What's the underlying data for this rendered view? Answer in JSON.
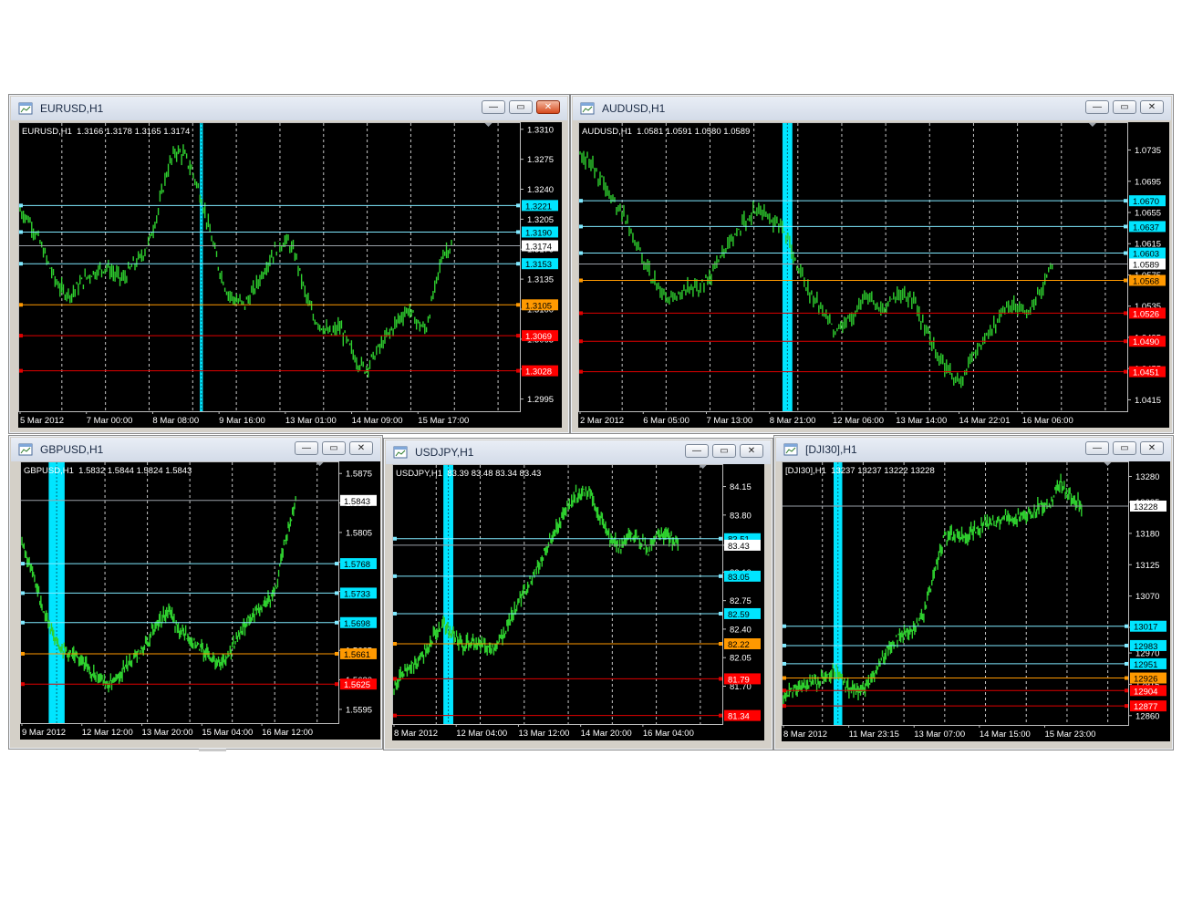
{
  "colors": {
    "background": "#000000",
    "candle": "#2fd12f",
    "grid": "#c8c8c8",
    "cyan_level": "#7fe9ff",
    "orange_level": "#ff9900",
    "red_level": "#e00000",
    "highlight_band": "#00e5ff",
    "price_tag": "#ffffff"
  },
  "icons": {
    "window": "chart-window-icon",
    "minimize": "minimize-icon",
    "maximize": "maximize-icon",
    "close": "close-icon"
  },
  "windows": [
    {
      "title": "EURUSD,H1",
      "info": "EURUSD,H1  1.3166 1.3178 1.3165 1.3174",
      "close_active": true,
      "ymin": 1.2985,
      "ymax": 1.3314,
      "y_ticks": [
        "1.3310",
        "1.3275",
        "1.3240",
        "1.3205",
        "1.3170",
        "1.3135",
        "1.3100",
        "1.3065",
        "1.3030",
        "1.2995"
      ],
      "x_labels": [
        "5 Mar 2012",
        "7 Mar 00:00",
        "8 Mar 08:00",
        "9 Mar 16:00",
        "13 Mar 01:00",
        "14 Mar 09:00",
        "15 Mar 17:00"
      ],
      "levels": [
        {
          "value": 1.3221,
          "label": "1.3221",
          "kind": "cyan"
        },
        {
          "value": 1.319,
          "label": "1.3190",
          "kind": "cyan"
        },
        {
          "value": 1.3153,
          "label": "1.3153",
          "kind": "cyan"
        },
        {
          "value": 1.3105,
          "label": "1.3105",
          "kind": "orange"
        },
        {
          "value": 1.3069,
          "label": "1.3069",
          "kind": "red"
        },
        {
          "value": 1.3028,
          "label": "1.3028",
          "kind": "red"
        }
      ],
      "current": {
        "value": 1.3174,
        "label": "1.3174"
      },
      "band_fraction": 0.362,
      "band_fraction_width": 0.006,
      "series": [
        1.3215,
        1.3205,
        1.3185,
        1.316,
        1.3135,
        1.312,
        1.3118,
        1.313,
        1.314,
        1.3145,
        1.315,
        1.314,
        1.3135,
        1.315,
        1.316,
        1.318,
        1.3215,
        1.326,
        1.3285,
        1.328,
        1.326,
        1.323,
        1.319,
        1.315,
        1.312,
        1.311,
        1.3105,
        1.312,
        1.314,
        1.316,
        1.3175,
        1.318,
        1.316,
        1.312,
        1.309,
        1.308,
        1.307,
        1.308,
        1.306,
        1.304,
        1.303,
        1.3045,
        1.306,
        1.3075,
        1.309,
        1.31,
        1.3085,
        1.3075,
        1.312,
        1.3165,
        1.3174
      ]
    },
    {
      "title": "AUDUSD,H1",
      "info": "AUDUSD,H1  1.0581 1.0591 1.0580 1.0589",
      "close_active": false,
      "ymin": 1.0405,
      "ymax": 1.0766,
      "y_ticks": [
        "1.0735",
        "1.0695",
        "1.0655",
        "1.0615",
        "1.0575",
        "1.0535",
        "1.0495",
        "1.0455",
        "1.0415"
      ],
      "x_labels": [
        "2 Mar 2012",
        "6 Mar 05:00",
        "7 Mar 13:00",
        "8 Mar 21:00",
        "12 Mar 06:00",
        "13 Mar 14:00",
        "14 Mar 22:01",
        "16 Mar 06:00"
      ],
      "levels": [
        {
          "value": 1.067,
          "label": "1.0670",
          "kind": "cyan"
        },
        {
          "value": 1.0637,
          "label": "1.0637",
          "kind": "cyan"
        },
        {
          "value": 1.0603,
          "label": "1.0603",
          "kind": "cyan"
        },
        {
          "value": 1.0568,
          "label": "1.0568",
          "kind": "orange"
        },
        {
          "value": 1.0526,
          "label": "1.0526",
          "kind": "red"
        },
        {
          "value": 1.049,
          "label": "1.0490",
          "kind": "red"
        },
        {
          "value": 1.0451,
          "label": "1.0451",
          "kind": "red"
        }
      ],
      "current": {
        "value": 1.0589,
        "label": "1.0589"
      },
      "band_fraction": 0.372,
      "band_fraction_width": 0.018,
      "series": [
        1.073,
        1.072,
        1.07,
        1.068,
        1.066,
        1.064,
        1.061,
        1.058,
        1.0555,
        1.054,
        1.055,
        1.056,
        1.0555,
        1.057,
        1.059,
        1.061,
        1.063,
        1.065,
        1.066,
        1.065,
        1.064,
        1.062,
        1.059,
        1.056,
        1.054,
        1.052,
        1.05,
        1.051,
        1.053,
        1.0545,
        1.054,
        1.053,
        1.0545,
        1.055,
        1.054,
        1.051,
        1.048,
        1.046,
        1.044,
        1.0445,
        1.047,
        1.049,
        1.051,
        1.053,
        1.054,
        1.0525,
        1.0535,
        1.056,
        1.0589
      ]
    },
    {
      "title": "GBPUSD,H1",
      "info": "GBPUSD,H1  1.5832 1.5844 1.5824 1.5843",
      "close_active": false,
      "ymin": 1.5583,
      "ymax": 1.5885,
      "y_ticks": [
        "1.5875",
        "1.5840",
        "1.5805",
        "1.5770",
        "1.5735",
        "1.5700",
        "1.5665",
        "1.5630",
        "1.5595"
      ],
      "x_labels": [
        "9 Mar 2012",
        "12 Mar 12:00",
        "13 Mar 20:00",
        "15 Mar 04:00",
        "16 Mar 12:00"
      ],
      "levels": [
        {
          "value": 1.5768,
          "label": "1.5768",
          "kind": "cyan"
        },
        {
          "value": 1.5733,
          "label": "1.5733",
          "kind": "cyan"
        },
        {
          "value": 1.5698,
          "label": "1.5698",
          "kind": "cyan"
        },
        {
          "value": 1.5661,
          "label": "1.5661",
          "kind": "orange"
        },
        {
          "value": 1.5625,
          "label": "1.5625",
          "kind": "red"
        }
      ],
      "current": {
        "value": 1.5843,
        "label": "1.5843"
      },
      "band_fraction": 0.09,
      "band_fraction_width": 0.05,
      "series": [
        1.579,
        1.576,
        1.572,
        1.569,
        1.5665,
        1.566,
        1.5655,
        1.564,
        1.563,
        1.5625,
        1.5635,
        1.565,
        1.566,
        1.568,
        1.57,
        1.571,
        1.569,
        1.568,
        1.567,
        1.566,
        1.565,
        1.5655,
        1.568,
        1.57,
        1.571,
        1.572,
        1.574,
        1.58,
        1.5843
      ]
    },
    {
      "title": "USDJPY,H1",
      "info": "USDJPY,H1  83.39 83.48 83.34 83.43",
      "close_active": false,
      "ymin": 81.28,
      "ymax": 84.38,
      "y_ticks": [
        "84.15",
        "83.80",
        "83.43",
        "83.10",
        "82.75",
        "82.40",
        "82.05",
        "81.70"
      ],
      "x_labels": [
        "8 Mar 2012",
        "12 Mar 04:00",
        "13 Mar 12:00",
        "14 Mar 20:00",
        "16 Mar 04:00"
      ],
      "levels": [
        {
          "value": 83.51,
          "label": "83.51",
          "kind": "cyan"
        },
        {
          "value": 83.05,
          "label": "83.05",
          "kind": "cyan"
        },
        {
          "value": 82.59,
          "label": "82.59",
          "kind": "cyan"
        },
        {
          "value": 82.22,
          "label": "82.22",
          "kind": "orange"
        },
        {
          "value": 81.79,
          "label": "81.79",
          "kind": "red"
        },
        {
          "value": 81.34,
          "label": "81.34",
          "kind": "red"
        }
      ],
      "current": {
        "value": 83.43,
        "label": "83.43"
      },
      "band_fraction": 0.155,
      "band_fraction_width": 0.03,
      "series": [
        81.7,
        81.85,
        81.95,
        82.1,
        82.3,
        82.45,
        82.35,
        82.2,
        82.25,
        82.2,
        82.15,
        82.3,
        82.55,
        82.8,
        83.0,
        83.25,
        83.5,
        83.75,
        83.95,
        84.1,
        84.05,
        83.8,
        83.55,
        83.4,
        83.55,
        83.5,
        83.35,
        83.6,
        83.55,
        83.43
      ]
    },
    {
      "title": "[DJI30],H1",
      "info": "[DJI30],H1  13237 13237 13222 13228",
      "close_active": false,
      "ymin": 12850,
      "ymax": 13300,
      "y_ticks": [
        "13280",
        "13235",
        "13180",
        "13125",
        "13070",
        "13015",
        "12970",
        "12915",
        "12860"
      ],
      "x_labels": [
        "8 Mar 2012",
        "11 Mar 23:15",
        "13 Mar 07:00",
        "14 Mar 15:00",
        "15 Mar 23:00"
      ],
      "levels": [
        {
          "value": 13017,
          "label": "13017",
          "kind": "cyan"
        },
        {
          "value": 12983,
          "label": "12983",
          "kind": "cyan"
        },
        {
          "value": 12951,
          "label": "12951",
          "kind": "cyan"
        },
        {
          "value": 12926,
          "label": "12926",
          "kind": "orange"
        },
        {
          "value": 12904,
          "label": "12904",
          "kind": "red"
        },
        {
          "value": 12877,
          "label": "12877",
          "kind": "red"
        }
      ],
      "current": {
        "value": 13228,
        "label": "13228"
      },
      "band_fraction": 0.15,
      "band_fraction_width": 0.025,
      "series": [
        12890,
        12910,
        12915,
        12920,
        12930,
        12940,
        12910,
        12900,
        12920,
        12950,
        12980,
        13000,
        13010,
        13030,
        13100,
        13170,
        13180,
        13175,
        13185,
        13195,
        13200,
        13210,
        13205,
        13215,
        13225,
        13230,
        13270,
        13240,
        13228
      ]
    }
  ]
}
